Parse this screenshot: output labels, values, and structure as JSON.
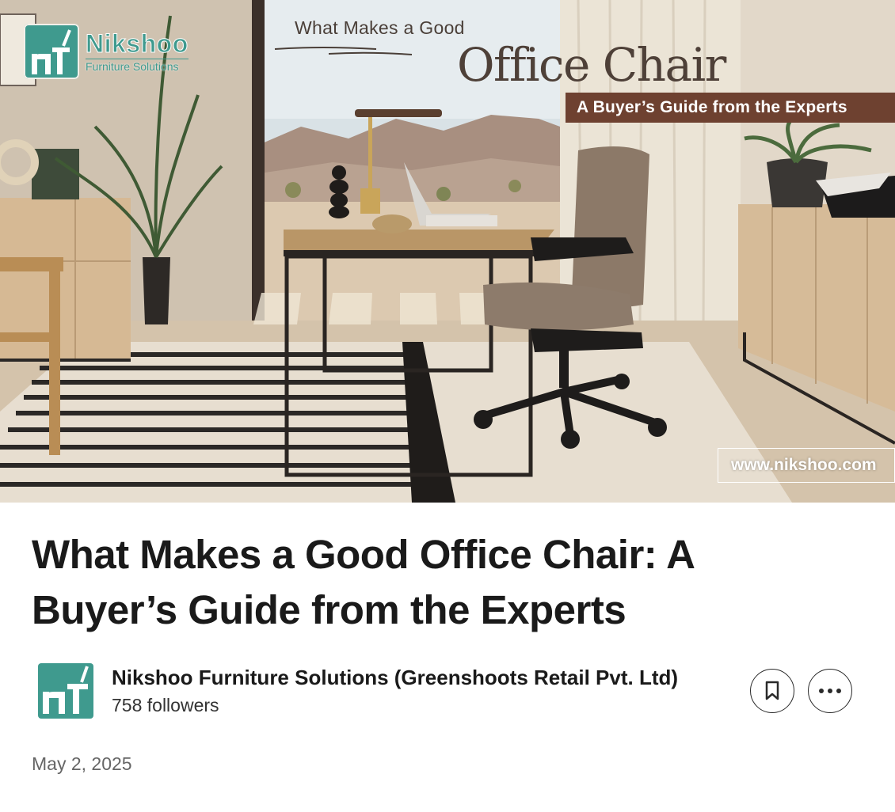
{
  "banner": {
    "brand_name": "Nikshoo",
    "brand_tagline": "Furniture Solutions",
    "kicker": "What Makes a Good",
    "headline": "Office Chair",
    "subheadline": "A Buyer’s Guide from the Experts",
    "url": "www.nikshoo.com"
  },
  "article": {
    "title": "What Makes a Good Office Chair: A Buyer’s Guide from the Experts",
    "date": "May 2, 2025"
  },
  "author": {
    "name": "Nikshoo Furniture Solutions (Greenshoots Retail Pvt. Ltd)",
    "followers": "758 followers",
    "logo_icon": "nikshoo-logo"
  },
  "actions": {
    "save_icon": "bookmark-icon",
    "more_icon": "ellipsis-icon"
  },
  "colors": {
    "brand_teal": "#3f9a8e",
    "banner_brown": "#6e4130",
    "text_primary": "#1a1a1a",
    "text_secondary": "#666666"
  }
}
